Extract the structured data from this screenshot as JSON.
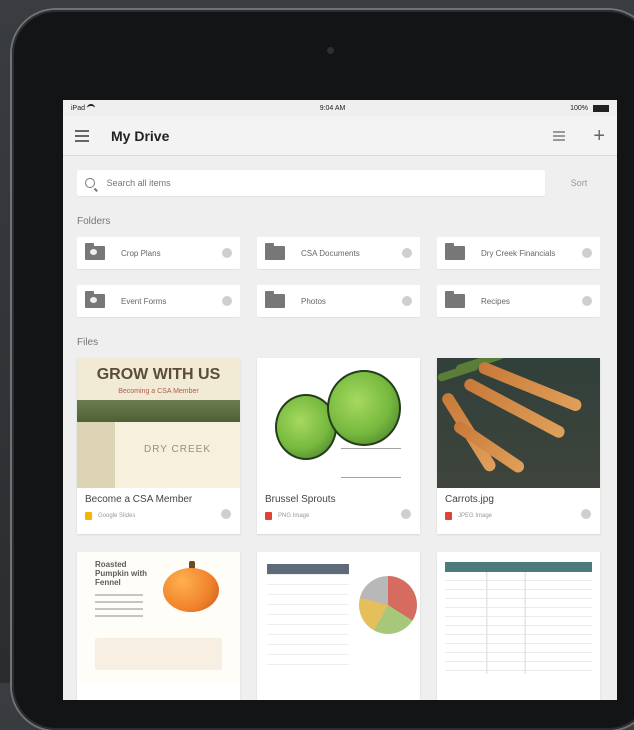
{
  "status_bar": {
    "carrier": "iPad",
    "time": "9:04 AM",
    "battery": "100%"
  },
  "header": {
    "title": "My Drive"
  },
  "search": {
    "placeholder": "Search all items",
    "sort_label": "Sort"
  },
  "sections": {
    "folders_label": "Folders",
    "files_label": "Files"
  },
  "folders": [
    {
      "name": "Crop Plans",
      "shared": true,
      "icon": "shared-folder-icon"
    },
    {
      "name": "CSA Documents",
      "shared": false,
      "icon": "folder-icon"
    },
    {
      "name": "Dry Creek Financials",
      "shared": false,
      "icon": "folder-icon"
    },
    {
      "name": "Event Forms",
      "shared": true,
      "icon": "shared-folder-icon"
    },
    {
      "name": "Photos",
      "shared": false,
      "icon": "folder-icon"
    },
    {
      "name": "Recipes",
      "shared": false,
      "icon": "folder-icon"
    }
  ],
  "files": [
    {
      "name": "Become a CSA Member",
      "type": "Google Slides",
      "type_color": "#f4b400",
      "thumb": {
        "headline": "GROW WITH US",
        "subhead": "Becoming a CSA Member",
        "brand": "DRY CREEK"
      }
    },
    {
      "name": "Brussel Sprouts",
      "type": "PNG Image",
      "type_color": "#db4437",
      "thumb": {}
    },
    {
      "name": "Carrots.jpg",
      "type": "JPEG Image",
      "type_color": "#db4437",
      "thumb": {}
    }
  ],
  "preview_cards": [
    {
      "title": "Roasted Pumpkin with Fennel"
    },
    {
      "title": ""
    },
    {
      "title": ""
    }
  ]
}
